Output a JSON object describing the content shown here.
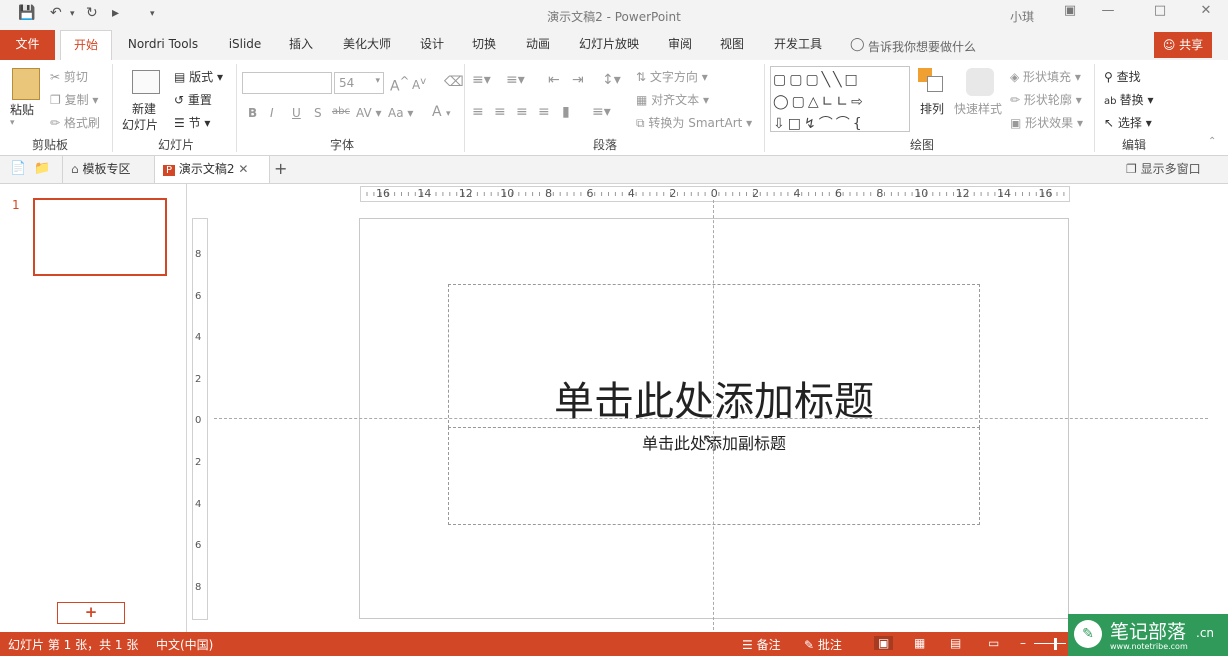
{
  "window": {
    "title": "演示文稿2  -  PowerPoint",
    "user": "小琪"
  },
  "tabs": {
    "file": "文件",
    "items": [
      "开始",
      "Nordri Tools",
      "iSlide",
      "插入",
      "美化大师",
      "设计",
      "切换",
      "动画",
      "幻灯片放映",
      "审阅",
      "视图",
      "开发工具"
    ],
    "tell_me": "告诉我你想要做什么",
    "share": "共享"
  },
  "ribbon": {
    "clipboard": {
      "paste": "粘贴",
      "cut": "剪切",
      "copy": "复制",
      "format_painter": "格式刷",
      "label": "剪贴板"
    },
    "slides": {
      "new_slide_1": "新建",
      "new_slide_2": "幻灯片",
      "layout": "版式",
      "reset": "重置",
      "section": "节",
      "label": "幻灯片"
    },
    "font": {
      "font_name": "",
      "font_size": "54",
      "bold": "B",
      "italic": "I",
      "underline": "U",
      "shadow": "S",
      "strike": "abc",
      "spacing": "AV",
      "case": "Aa",
      "color": "A",
      "grow": "A",
      "shrink": "A",
      "label": "字体"
    },
    "paragraph": {
      "text_direction": "文字方向",
      "align_text": "对齐文本",
      "smartart": "转换为 SmartArt",
      "label": "段落"
    },
    "drawing": {
      "arrange": "排列",
      "quick_styles": "快速样式",
      "shape_fill": "形状填充",
      "shape_outline": "形状轮廓",
      "shape_effects": "形状效果",
      "label": "绘图"
    },
    "editing": {
      "find": "查找",
      "replace": "替换",
      "select": "选择",
      "label": "编辑"
    }
  },
  "doctabs": {
    "template": "模板专区",
    "document": "演示文稿2",
    "multi_window": "显示多窗口"
  },
  "thumbnails": {
    "slide_number": "1",
    "add_button": "+"
  },
  "rulers": {
    "h_ticks": [
      "16",
      "14",
      "12",
      "10",
      "8",
      "6",
      "4",
      "2",
      "0",
      "2",
      "4",
      "6",
      "8",
      "10",
      "12",
      "14",
      "16"
    ],
    "v_ticks": [
      "8",
      "6",
      "4",
      "2",
      "0",
      "2",
      "4",
      "6",
      "8"
    ]
  },
  "slide": {
    "title_placeholder": "单击此处添加标题",
    "subtitle_placeholder": "单击此处添加副标题"
  },
  "status": {
    "slide_info": "幻灯片 第 1 张，共 1 张",
    "language": "中文(中国)",
    "notes": "备注",
    "comments": "批注"
  },
  "watermark": {
    "text": "笔记部落",
    "url": "www.notetribe.com",
    "suffix": ".cn"
  },
  "colors": {
    "accent": "#d24726",
    "chrome": "#f3f3f3"
  }
}
